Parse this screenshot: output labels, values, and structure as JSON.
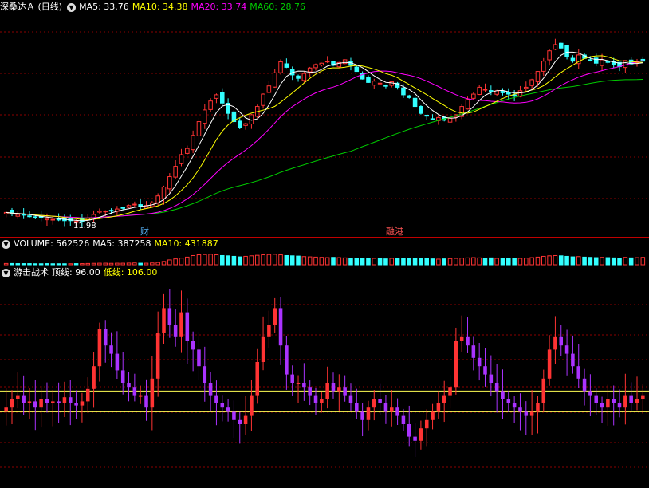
{
  "price_panel": {
    "title": "深桑达Ａ (日线)",
    "indicators": [
      {
        "label": "MA5: 33.76",
        "color": "#ffffff"
      },
      {
        "label": "MA10: 34.38",
        "color": "#ffff00"
      },
      {
        "label": "MA20: 33.74",
        "color": "#ff00ff"
      },
      {
        "label": "MA60: 28.76",
        "color": "#00cc00"
      }
    ],
    "low_label": "11.98",
    "event_labels": [
      {
        "text": "财",
        "color": "#5ab8ff"
      },
      {
        "text": "融港",
        "color": "#ff5555"
      }
    ]
  },
  "volume_panel": {
    "indicators": [
      {
        "label": "VOLUME: 562526",
        "color": "#ffffff"
      },
      {
        "label": "MA5: 387258",
        "color": "#ffffff"
      },
      {
        "label": "MA10: 431887",
        "color": "#ffff00"
      }
    ]
  },
  "indicator_panel": {
    "name": "游击战术",
    "indicators": [
      {
        "label": "顶线: 96.00",
        "color": "#ffffff"
      },
      {
        "label": "低线: 106.00",
        "color": "#ffff00"
      }
    ]
  },
  "colors": {
    "up": "#ff3333",
    "down": "#33ffff",
    "ma5": "#ffffff",
    "ma10": "#ffff00",
    "ma20": "#ff00ff",
    "ma60": "#00cc00",
    "osc_up": "#ff3333",
    "osc_down": "#aa33ff"
  },
  "chart_data": [
    {
      "type": "candlestick",
      "title": "深桑达Ａ (日线)",
      "ylim": [
        10,
        42
      ],
      "closes": [
        13.2,
        13.0,
        12.9,
        12.8,
        12.6,
        12.5,
        12.4,
        12.3,
        12.2,
        12.1,
        12.0,
        12.0,
        11.9,
        11.9,
        12.4,
        12.9,
        13.4,
        13.4,
        13.5,
        13.7,
        13.9,
        14.2,
        14.4,
        14.1,
        14.2,
        14.6,
        15.6,
        16.9,
        18.4,
        19.9,
        21.6,
        22.5,
        24.4,
        26.4,
        28.1,
        29.4,
        30.3,
        29.1,
        27.6,
        26.4,
        25.5,
        26.1,
        27.4,
        28.6,
        30.4,
        31.6,
        33.5,
        35.1,
        34.3,
        33.2,
        32.7,
        33.4,
        34.2,
        34.7,
        34.9,
        35.2,
        34.6,
        35.0,
        35.4,
        34.6,
        33.7,
        32.6,
        32.1,
        32.3,
        32.0,
        31.6,
        32.2,
        31.4,
        30.3,
        29.9,
        28.6,
        27.6,
        27.2,
        26.8,
        27.0,
        26.6,
        26.9,
        27.4,
        28.6,
        29.6,
        30.4,
        31.4,
        31.1,
        30.7,
        30.9,
        30.6,
        30.4,
        30.1,
        30.9,
        31.4,
        32.5,
        33.7,
        35.2,
        36.7,
        37.6,
        37.1,
        35.9,
        35.2,
        36.1,
        35.6,
        35.3,
        34.9,
        35.4,
        35.1,
        34.7,
        34.4,
        35.3,
        34.8,
        35.1,
        35.2
      ]
    },
    {
      "type": "bar",
      "title": "VOLUME",
      "values": [
        0.1,
        0.1,
        0.09,
        0.09,
        0.09,
        0.08,
        0.08,
        0.09,
        0.08,
        0.08,
        0.08,
        0.08,
        0.09,
        0.09,
        0.1,
        0.11,
        0.12,
        0.12,
        0.11,
        0.12,
        0.12,
        0.13,
        0.14,
        0.12,
        0.12,
        0.14,
        0.18,
        0.26,
        0.38,
        0.46,
        0.52,
        0.6,
        0.72,
        0.78,
        0.8,
        0.82,
        0.78,
        0.72,
        0.7,
        0.66,
        0.62,
        0.66,
        0.7,
        0.74,
        0.78,
        0.8,
        0.82,
        0.78,
        0.72,
        0.7,
        0.68,
        0.64,
        0.62,
        0.6,
        0.58,
        0.56,
        0.58,
        0.56,
        0.54,
        0.52,
        0.52,
        0.5,
        0.52,
        0.5,
        0.48,
        0.46,
        0.5,
        0.52,
        0.5,
        0.48,
        0.52,
        0.5,
        0.48,
        0.46,
        0.44,
        0.46,
        0.48,
        0.5,
        0.52,
        0.54,
        0.56,
        0.54,
        0.52,
        0.54,
        0.5,
        0.48,
        0.5,
        0.48,
        0.5,
        0.52,
        0.56,
        0.6,
        0.66,
        0.7,
        0.72,
        0.7,
        0.66,
        0.62,
        0.64,
        0.6,
        0.58,
        0.56,
        0.58,
        0.56,
        0.54,
        0.52,
        0.58,
        0.54,
        0.56,
        0.58
      ]
    },
    {
      "type": "bar",
      "title": "游击战术",
      "ylim": [
        60,
        160
      ],
      "reference_lines": [
        {
          "name": "顶线",
          "value": 96
        },
        {
          "name": "低线",
          "value": 106
        }
      ],
      "values": [
        98,
        102,
        104,
        100,
        101,
        98,
        102,
        100,
        101,
        100,
        103,
        100,
        99,
        101,
        107,
        118,
        136,
        128,
        124,
        116,
        110,
        108,
        104,
        104,
        98,
        112,
        134,
        146,
        138,
        132,
        144,
        130,
        126,
        118,
        110,
        104,
        100,
        98,
        96,
        92,
        90,
        94,
        104,
        120,
        132,
        138,
        146,
        128,
        114,
        110,
        110,
        108,
        104,
        100,
        102,
        110,
        106,
        108,
        104,
        100,
        96,
        92,
        98,
        102,
        100,
        96,
        98,
        94,
        90,
        84,
        82,
        88,
        92,
        96,
        100,
        104,
        108,
        130,
        132,
        128,
        122,
        118,
        114,
        110,
        106,
        102,
        100,
        98,
        96,
        94,
        96,
        100,
        112,
        126,
        132,
        128,
        124,
        118,
        112,
        106,
        104,
        100,
        98,
        102,
        100,
        98,
        104,
        100,
        102,
        104
      ]
    }
  ]
}
